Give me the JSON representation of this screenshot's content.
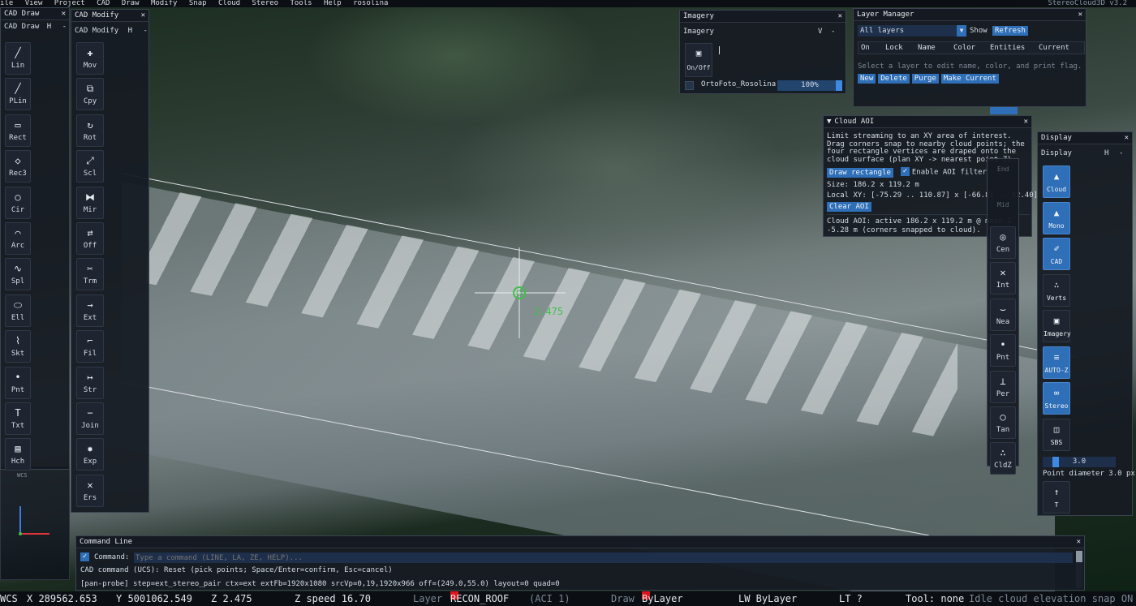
{
  "menubar": {
    "items": [
      "ile",
      "View",
      "Project",
      "CAD",
      "Draw",
      "Modify",
      "Snap",
      "Cloud",
      "Stereo",
      "Tools",
      "Help"
    ],
    "project": "rosolina",
    "version": "StereoCloud3D v3.2"
  },
  "cad_draw": {
    "title": "CAD Draw",
    "subtitle": "CAD Draw",
    "h_label": "H",
    "minus": "-",
    "close": "✕",
    "tools": [
      {
        "label": "Lin",
        "icon": "╱"
      },
      {
        "label": "PLin",
        "icon": "╱"
      },
      {
        "label": "Rect",
        "icon": "▭"
      },
      {
        "label": "Rec3",
        "icon": "◇"
      },
      {
        "label": "Cir",
        "icon": "○"
      },
      {
        "label": "Arc",
        "icon": "⌒"
      },
      {
        "label": "Spl",
        "icon": "∿"
      },
      {
        "label": "Ell",
        "icon": "⬭"
      },
      {
        "label": "Skt",
        "icon": "⌇"
      },
      {
        "label": "Pnt",
        "icon": "•"
      },
      {
        "label": "Txt",
        "icon": "T"
      },
      {
        "label": "Hch",
        "icon": "▤"
      }
    ]
  },
  "cad_modify": {
    "title": "CAD Modify",
    "subtitle": "CAD Modify",
    "h_label": "H",
    "minus": "-",
    "close": "✕",
    "tools": [
      {
        "label": "Mov",
        "icon": "✚"
      },
      {
        "label": "Cpy",
        "icon": "⧉"
      },
      {
        "label": "Rot",
        "icon": "↻"
      },
      {
        "label": "Scl",
        "icon": "⤢"
      },
      {
        "label": "Mir",
        "icon": "⧓"
      },
      {
        "label": "Off",
        "icon": "⇄"
      },
      {
        "label": "Trm",
        "icon": "✂"
      },
      {
        "label": "Ext",
        "icon": "→"
      },
      {
        "label": "Fil",
        "icon": "⌐"
      },
      {
        "label": "Str",
        "icon": "↦"
      },
      {
        "label": "Join",
        "icon": "−"
      },
      {
        "label": "Exp",
        "icon": "✸"
      },
      {
        "label": "Ers",
        "icon": "✕"
      }
    ]
  },
  "imagery": {
    "title": "Imagery",
    "subtitle": "Imagery",
    "v_label": "V",
    "minus": "-",
    "close": "✕",
    "onoff_label": "On/Off",
    "layer_name": "OrtoFoto_Rosolina",
    "opacity": "100%",
    "opacity_value": 1.0,
    "icon": "▣"
  },
  "layer_manager": {
    "title": "Layer Manager",
    "close": "✕",
    "filter_value": "All layers",
    "show_label": "Show",
    "refresh_label": "Refresh",
    "columns": [
      "On",
      "Lock",
      "Name",
      "Color",
      "Entities",
      "Current"
    ],
    "hint": "Select a layer to edit name, color, and print flag.",
    "buttons": [
      "New",
      "Delete",
      "Purge",
      "Make Current"
    ]
  },
  "cloud_aoi": {
    "title": "Cloud AOI",
    "close": "✕",
    "description": "Limit streaming to an XY area of interest. Drag corners snap to nearby cloud points; the four rectangle vertices are draped onto the cloud surface (plan XY -> nearest point Z).",
    "draw_button": "Draw rectangle",
    "enable_label": "Enable AOI filter",
    "size": "Size: 186.2 x 119.2 m",
    "local_xy": "Local XY: [-75.29 .. 110.87] x [-66.81 .. 52.40]",
    "clear_button": "Clear AOI",
    "status": "Cloud AOI: active 186.2 x 119.2 m @ mean Z -5.28 m (corners snapped to cloud)."
  },
  "snap_toolbar": {
    "hidden_label_top": "End",
    "hidden_label_mid": "Mid",
    "tools": [
      {
        "label": "Cen",
        "icon": "◎"
      },
      {
        "label": "Int",
        "icon": "✕"
      },
      {
        "label": "Nea",
        "icon": "⌣"
      },
      {
        "label": "Pnt",
        "icon": "•"
      },
      {
        "label": "Per",
        "icon": "⊥"
      },
      {
        "label": "Tan",
        "icon": "○"
      },
      {
        "label": "CldZ",
        "icon": "∴"
      }
    ]
  },
  "display": {
    "title": "Display",
    "subtitle": "Display",
    "h_label": "H",
    "minus": "-",
    "close": "✕",
    "buttons": [
      {
        "label": "Cloud",
        "icon": "▲",
        "on": true
      },
      {
        "label": "Mono",
        "icon": "▲",
        "on": true
      },
      {
        "label": "CAD",
        "icon": "✐",
        "on": true
      },
      {
        "label": "Verts",
        "icon": "∴",
        "on": false
      },
      {
        "label": "Imagery",
        "icon": "▣",
        "on": false
      },
      {
        "label": "AUTO-Z",
        "icon": "≡",
        "on": true
      },
      {
        "label": "Stereo",
        "icon": "∞",
        "on": true
      },
      {
        "label": "SBS",
        "icon": "◫",
        "on": false
      },
      {
        "label": "T",
        "icon": "↑",
        "on": false
      }
    ],
    "point_size_value": "3.0",
    "point_size": 3.0,
    "point_size_max": 20,
    "point_diameter": "Point diameter 3.0 px"
  },
  "viewport": {
    "cursor_label": "2.475",
    "ucs_label": "WCS",
    "accent_green": "#3fbf4a"
  },
  "command_line": {
    "title": "Command Line",
    "close": "✕",
    "check": "✓",
    "prompt_label": "Command:",
    "placeholder": "Type a command (LINE, LA, ZE, HELP)...",
    "line1": "CAD command (UCS): Reset (pick points; Space/Enter=confirm, Esc=cancel)",
    "line2": "[pan-probe] step=ext_stereo_pair ctx=ext extFb=1920x1080 srcVp=0,19,1920x966 off=(249.0,55.0) layout=0 quad=0"
  },
  "status_bar": {
    "ucs": "WCS",
    "x": "X 289562.653",
    "y": "Y 5001062.549",
    "z": "Z 2.475",
    "zspeed": "Z speed 16.70",
    "layer_label": "Layer",
    "layer_name": "RECON_ROOF",
    "layer_aci": "(ACI 1)",
    "draw_label": "Draw",
    "draw_value": "ByLayer",
    "lw": "LW ByLayer",
    "lt": "LT ?",
    "tool": "Tool: none",
    "idle": "Idle cloud elevation snap ON",
    "accent_red": "#e0141a"
  }
}
